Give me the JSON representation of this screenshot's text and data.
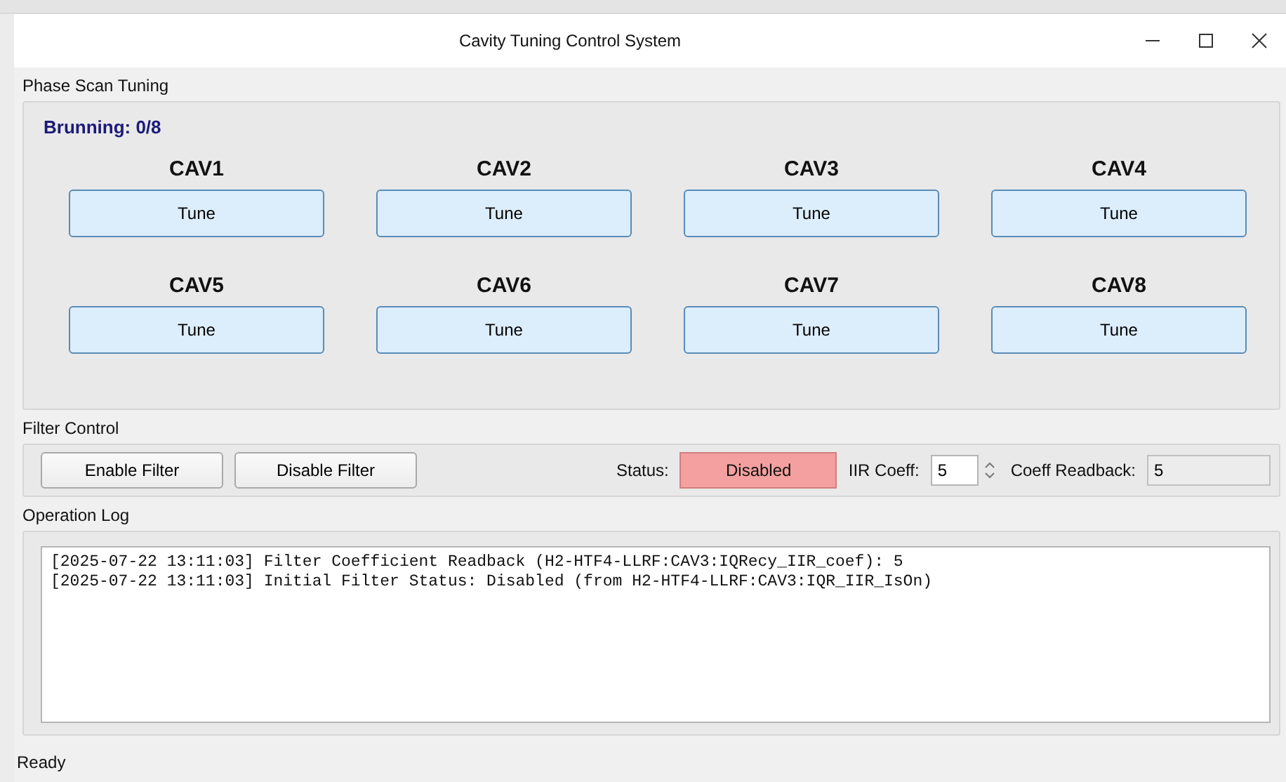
{
  "window": {
    "title": "Cavity Tuning Control System"
  },
  "phase_scan": {
    "title": "Phase Scan Tuning",
    "running": "Brunning: 0/8",
    "cavities": [
      {
        "name": "CAV1",
        "button": "Tune"
      },
      {
        "name": "CAV2",
        "button": "Tune"
      },
      {
        "name": "CAV3",
        "button": "Tune"
      },
      {
        "name": "CAV4",
        "button": "Tune"
      },
      {
        "name": "CAV5",
        "button": "Tune"
      },
      {
        "name": "CAV6",
        "button": "Tune"
      },
      {
        "name": "CAV7",
        "button": "Tune"
      },
      {
        "name": "CAV8",
        "button": "Tune"
      }
    ]
  },
  "filter_control": {
    "title": "Filter Control",
    "buttons": [
      "Enable Filter",
      "Disable Filter"
    ],
    "status_label": "Status:",
    "status": "Disabled",
    "enabled": false,
    "coeff_label": "IIR Coeff:",
    "coeff": "5",
    "readback_label": "Coeff Readback:",
    "readback": "5"
  },
  "operation_log": {
    "title": "Operation Log",
    "lines": [
      "[2025-07-22 13:11:03] Filter Coefficient Readback (H2-HTF4-LLRF:CAV3:IQRecy_IIR_coef): 5",
      "[2025-07-22 13:11:03] Initial Filter Status: Disabled (from H2-HTF4-LLRF:CAV3:IQR_IIR_IsOn)"
    ]
  },
  "status_bar": "Ready"
}
